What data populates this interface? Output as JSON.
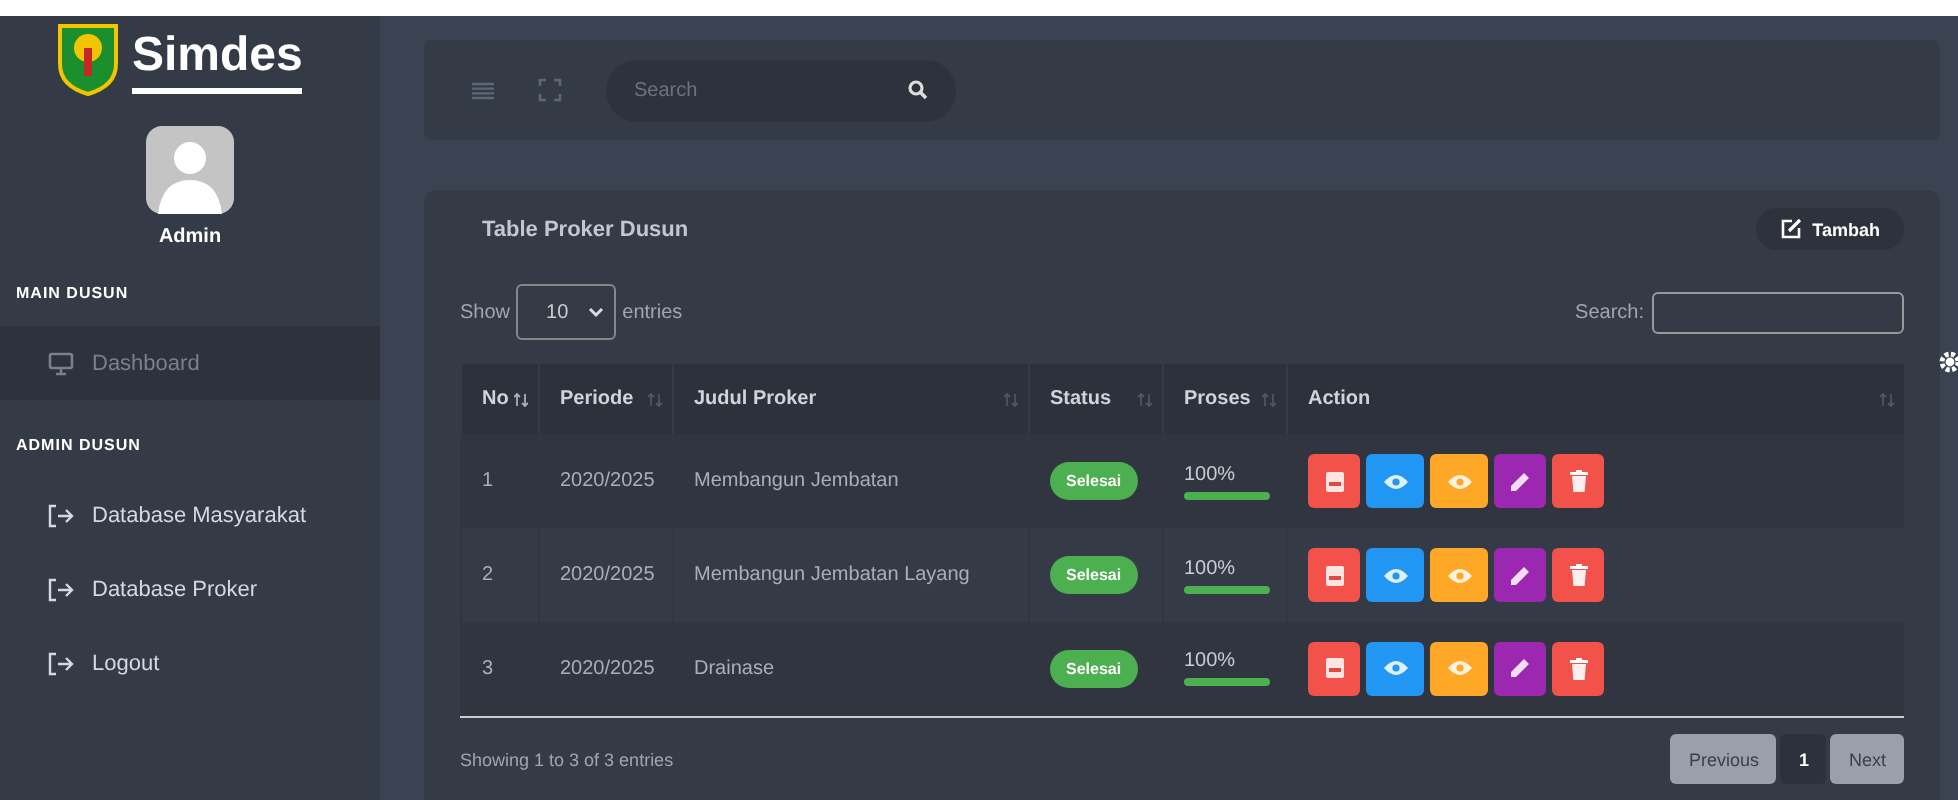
{
  "sidebar": {
    "brand": "Simdes",
    "user": "Admin",
    "sections": [
      {
        "heading": "MAIN DUSUN",
        "items": [
          {
            "label": "Dashboard",
            "kind": "monitor",
            "selected": true
          }
        ]
      },
      {
        "heading": "ADMIN DUSUN",
        "items": [
          {
            "label": "Database Masyarakat",
            "kind": "exit",
            "selected": false
          },
          {
            "label": "Database Proker",
            "kind": "exit",
            "selected": false
          },
          {
            "label": "Logout",
            "kind": "exit",
            "selected": false
          }
        ]
      }
    ]
  },
  "topbar": {
    "search": {
      "placeholder": "Search"
    }
  },
  "card": {
    "title": "Table Proker Dusun",
    "add_button": "Tambah",
    "length": {
      "prefix": "Show",
      "value": "10",
      "suffix": "entries"
    },
    "search_label": "Search:",
    "table": {
      "columns": [
        {
          "label": "No",
          "sorted": true
        },
        {
          "label": "Periode",
          "sorted": false
        },
        {
          "label": "Judul Proker",
          "sorted": false
        },
        {
          "label": "Status",
          "sorted": false
        },
        {
          "label": "Proses",
          "sorted": false
        },
        {
          "label": "Action",
          "sorted": false
        }
      ],
      "rows": [
        {
          "no": "1",
          "periode": "2020/2025",
          "judul": "Membangun Jembatan",
          "status": "Selesai",
          "reading": "100%",
          "level": 1,
          "actions": [
            {
              "kind": "print",
              "color": "#f2524a"
            },
            {
              "kind": "view",
              "color": "#2196f3"
            },
            {
              "kind": "view",
              "color": "#ffa726"
            },
            {
              "kind": "edit",
              "color": "#9c27b0"
            },
            {
              "kind": "delete",
              "color": "#f2524a"
            }
          ]
        },
        {
          "no": "2",
          "periode": "2020/2025",
          "judul": "Membangun Jembatan Layang",
          "status": "Selesai",
          "reading": "100%",
          "level": 1,
          "actions": [
            {
              "kind": "print",
              "color": "#f2524a"
            },
            {
              "kind": "view",
              "color": "#2196f3"
            },
            {
              "kind": "view",
              "color": "#ffa726"
            },
            {
              "kind": "edit",
              "color": "#9c27b0"
            },
            {
              "kind": "delete",
              "color": "#f2524a"
            }
          ]
        },
        {
          "no": "3",
          "periode": "2020/2025",
          "judul": "Drainase",
          "status": "Selesai",
          "reading": "100%",
          "level": 1,
          "actions": [
            {
              "kind": "print",
              "color": "#f2524a"
            },
            {
              "kind": "view",
              "color": "#2196f3"
            },
            {
              "kind": "view",
              "color": "#ffa726"
            },
            {
              "kind": "edit",
              "color": "#9c27b0"
            },
            {
              "kind": "delete",
              "color": "#f2524a"
            }
          ]
        }
      ]
    },
    "info": "Showing 1 to 3 of 3 entries",
    "pagination": [
      {
        "label": "Previous",
        "selected": false
      },
      {
        "label": "1",
        "selected": true
      },
      {
        "label": "Next",
        "selected": false
      }
    ]
  }
}
